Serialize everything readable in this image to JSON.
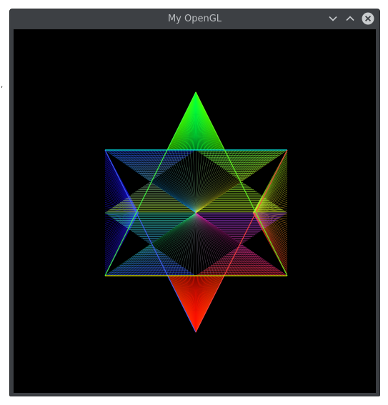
{
  "desktop": {
    "stray_mark": ","
  },
  "window": {
    "title": "My OpenGL",
    "buttons": {
      "minimize_icon": "chevron-down-icon",
      "maximize_icon": "chevron-up-icon",
      "close_icon": "close-icon"
    },
    "colors": {
      "frame": "#3b3e42",
      "title_text": "#b9bcbf",
      "close_circle": "#c9ccce",
      "client_background": "#000000"
    }
  },
  "scene": {
    "shape": "hexagram",
    "line_count_per_fan": 60,
    "colors": {
      "red": "#ff0000",
      "green": "#00ff00",
      "blue": "#0000ff",
      "yellow": "#ffff00",
      "cyan": "#00ffff",
      "magenta": "#ff00ff",
      "violet": "#8000ff"
    }
  }
}
